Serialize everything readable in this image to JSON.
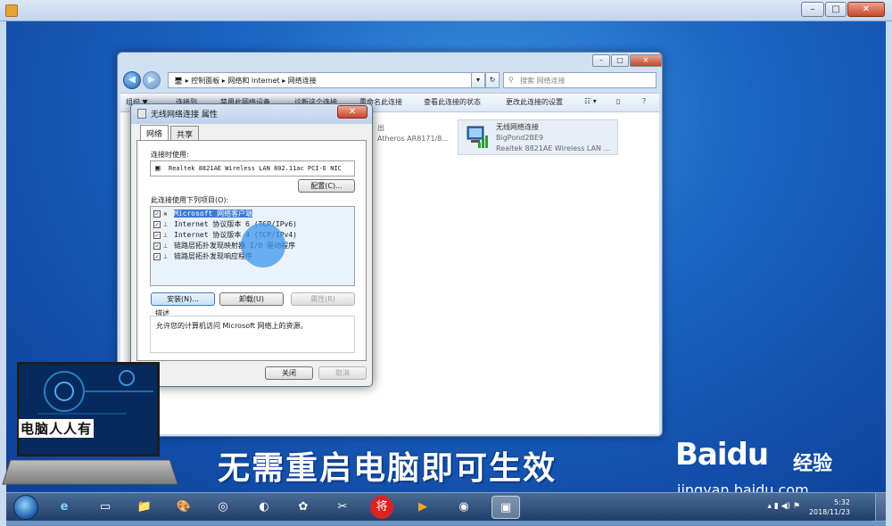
{
  "outer_window": {
    "controls": [
      "–",
      "□",
      "✕"
    ]
  },
  "explorer": {
    "breadcrumb": {
      "part1": "控制面板",
      "part2": "网络和 Internet",
      "part3": "网络连接"
    },
    "search_placeholder": "搜索 网络连接",
    "toolbar": [
      "组织 ▼",
      "连接到",
      "禁用此网络设备",
      "诊断这个连接",
      "重命名此连接",
      "查看此连接的状态",
      "更改此连接的设置"
    ],
    "adapters": [
      {
        "line1": "出",
        "line2": "Atheros AR8171/8..."
      },
      {
        "name": "无线网络连接",
        "ssid": "BigPond2BE9",
        "device": "Realtek 8821AE Wireless LAN ..."
      }
    ]
  },
  "dialog": {
    "title": "无线网络连接 属性",
    "close_label": "✕",
    "tabs": [
      "网络",
      "共享"
    ],
    "connect_using_label": "连接时使用:",
    "adapter_name": "Realtek 8821AE Wireless LAN 802.11ac PCI-E NIC",
    "configure_button": "配置(C)...",
    "items_label": "此连接使用下列项目(O):",
    "items": [
      {
        "text": "Microsoft 网络客户端",
        "checked": true,
        "selected": true
      },
      {
        "text": "Internet 协议版本 6 (TCP/IPv6)",
        "checked": true,
        "selected": false
      },
      {
        "text": "Internet 协议版本 4 (TCP/IPv4)",
        "checked": true,
        "selected": false
      },
      {
        "text": "链路层拓扑发现映射器 I/O 驱动程序",
        "checked": true,
        "selected": false
      },
      {
        "text": "链路层拓扑发现响应程序",
        "checked": true,
        "selected": false
      }
    ],
    "install_button": "安装(N)...",
    "uninstall_button": "卸载(U)",
    "properties_button": "属性(R)",
    "description_label": "描述",
    "description_text": "允许您的计算机访问 Microsoft 网络上的资源。",
    "close_button": "关闭",
    "cancel_button": "取消"
  },
  "caption": "无需重启电脑即可生效",
  "overlay_brand": "电脑人人有",
  "watermark": {
    "logo": "Baidu",
    "cn": "经验",
    "url": "jingyan.baidu.com"
  },
  "taskbar": {
    "apps": [
      "e",
      "▭",
      "📁",
      "🎨",
      "◎",
      "◐",
      "✿",
      "✂",
      "将",
      "▶",
      "◉",
      "▣"
    ],
    "time": "5:32",
    "date": "2018/11/23"
  }
}
